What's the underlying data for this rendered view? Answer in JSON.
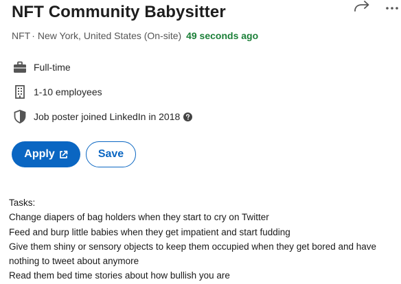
{
  "job": {
    "title": "NFT Community Babysitter",
    "company": "NFT",
    "separator": "·",
    "location": "New York, United States (On-site)",
    "posted": "49 seconds ago"
  },
  "insights": [
    {
      "icon": "briefcase-icon",
      "text": "Full-time"
    },
    {
      "icon": "building-icon",
      "text": "1-10 employees"
    },
    {
      "icon": "shield-icon",
      "text": "Job poster joined LinkedIn in 2018"
    }
  ],
  "actions": {
    "apply_label": "Apply",
    "save_label": "Save"
  },
  "description": {
    "heading": "Tasks:",
    "lines": [
      "Change diapers of bag holders when they start to cry on Twitter",
      "Feed and burp little babies when they get impatient and start fudding",
      "Give them shiny or sensory objects to keep them occupied when they get bored and have nothing to tweet about anymore",
      "Read them bed time stories about how bullish you are"
    ]
  },
  "colors": {
    "accent": "#0a66c2",
    "posted": "#1a7f37"
  }
}
